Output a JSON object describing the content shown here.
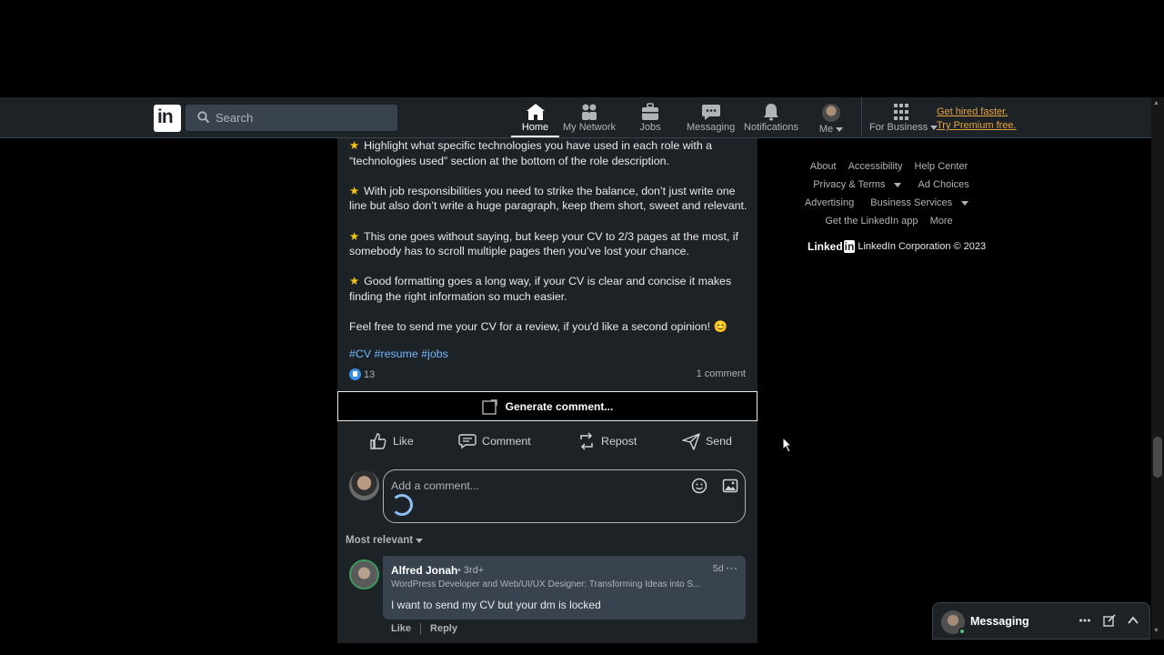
{
  "search": {
    "placeholder": "Search"
  },
  "nav": {
    "home": "Home",
    "network": "My Network",
    "jobs": "Jobs",
    "messaging": "Messaging",
    "notifications": "Notifications",
    "me": "Me",
    "business": "For Business",
    "premium_line1": "Get hired faster.",
    "premium_line2": "Try Premium free."
  },
  "post": {
    "tips": [
      "Highlight what specific technologies you have used in each role with a “technologies used” section at the bottom of the role description.",
      "With job responsibilities you need to strike the balance, don’t just write one line but also don’t write a huge paragraph, keep them short, sweet and relevant.",
      "This one goes without saying, but keep your CV to 2/3 pages at the most, if somebody has to scroll multiple pages then you’ve lost your chance.",
      "Good formatting goes a long way, if your CV is clear and concise it makes finding the right information so much easier."
    ],
    "closing": "Feel free to send me your CV for a review, if you'd like a second opinion! 😊",
    "hashtags": [
      "#CV",
      "#resume",
      "#jobs"
    ],
    "reaction_count": "13",
    "comment_count": "1 comment"
  },
  "generate_comment": "Generate comment...",
  "actions": {
    "like": "Like",
    "comment": "Comment",
    "repost": "Repost",
    "send": "Send"
  },
  "comment_box": {
    "placeholder": "Add a comment..."
  },
  "sort": "Most relevant",
  "comment": {
    "author": "Alfred Jonah",
    "degree": "• 3rd+",
    "headline": "WordPress Developer and Web/UI/UX Designer: Transforming Ideas into S...",
    "time": "5d",
    "text": "I want to send my CV but your dm is locked",
    "like": "Like",
    "reply": "Reply"
  },
  "footer": {
    "about": "About",
    "accessibility": "Accessibility",
    "help": "Help Center",
    "privacy": "Privacy & Terms",
    "ad_choices": "Ad Choices",
    "advertising": "Advertising",
    "business_services": "Business Services",
    "get_app": "Get the LinkedIn app",
    "more": "More",
    "brand": "Linked",
    "brand_in": "in",
    "copyright": "LinkedIn Corporation © 2023"
  },
  "messaging": {
    "title": "Messaging"
  },
  "colors": {
    "accent": "#71b7fb",
    "premium": "#e7a33e",
    "card": "#1d2226",
    "reaction": "#378fe9"
  }
}
